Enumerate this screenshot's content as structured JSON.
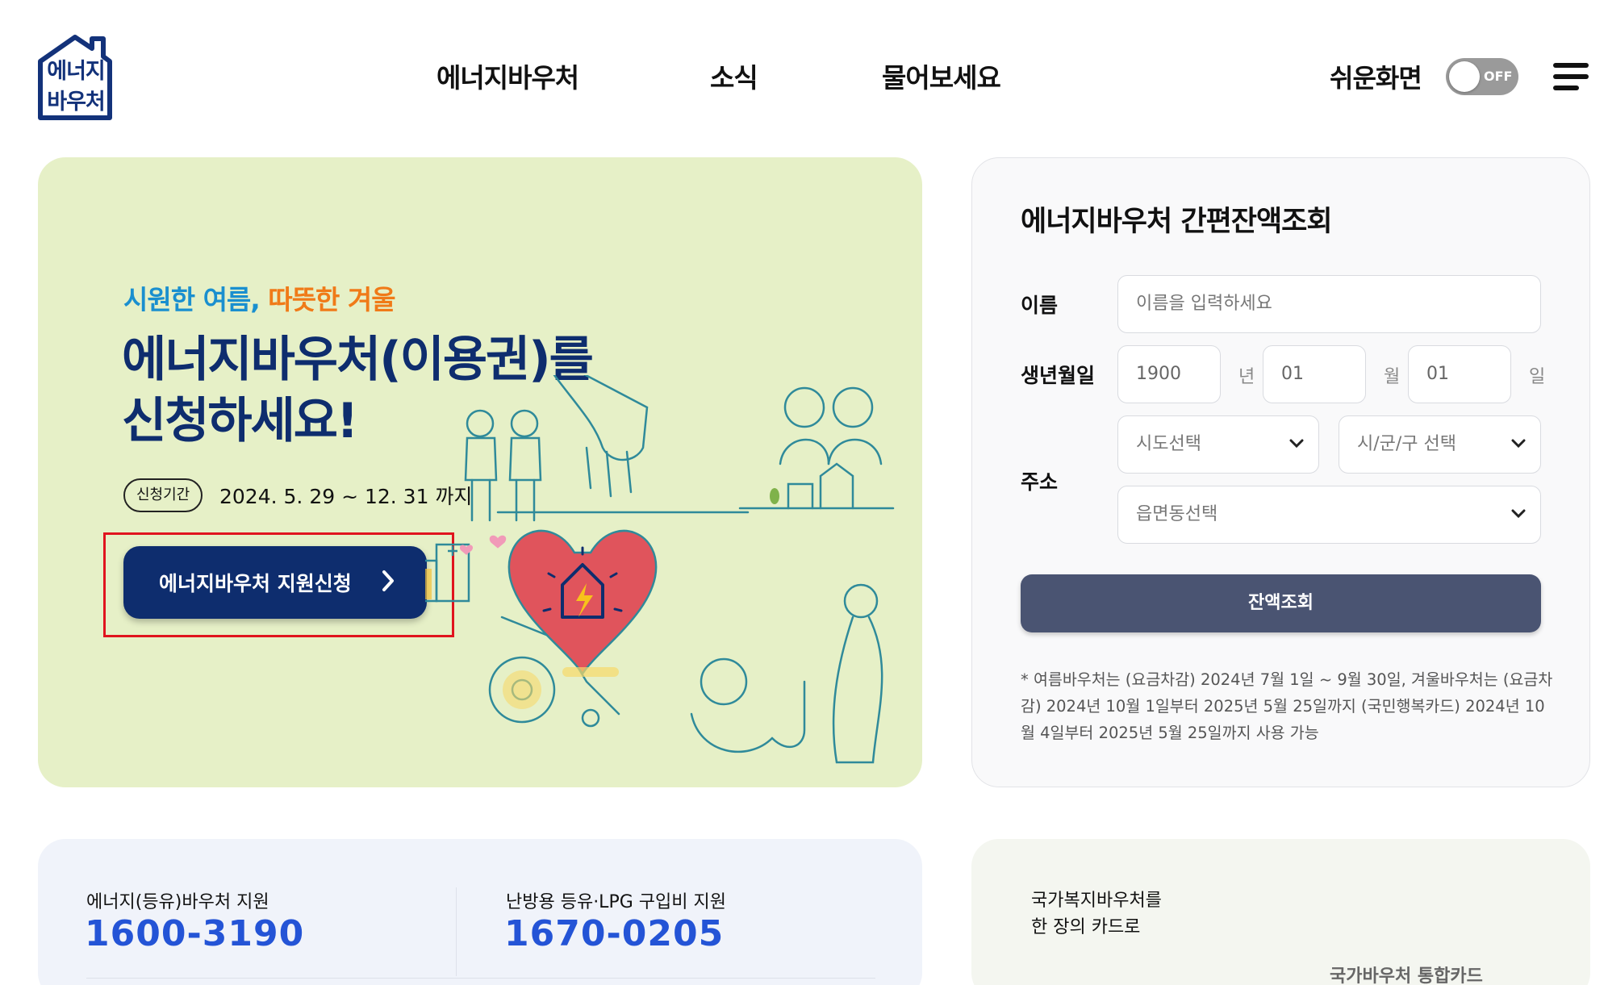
{
  "header": {
    "logo_line1": "에너지",
    "logo_line2": "바우처",
    "nav": [
      "에너지바우처",
      "소식",
      "물어보세요"
    ],
    "easy_screen_label": "쉬운화면",
    "toggle_state": "OFF"
  },
  "hero": {
    "subtitle_blue": "시원한 여름,",
    "subtitle_orange": "따뜻한 겨울",
    "title_line1": "에너지바우처(이용권)를",
    "title_line2": "신청하세요!",
    "period_badge": "신청기간",
    "period_text": "2024. 5. 29 ~ 12. 31 까지",
    "apply_button": "에너지바우처 지원신청"
  },
  "balance": {
    "title": "에너지바우처 간편잔액조회",
    "name_label": "이름",
    "name_placeholder": "이름을 입력하세요",
    "birth_label": "생년월일",
    "year_value": "1900",
    "year_unit": "년",
    "month_value": "01",
    "month_unit": "월",
    "day_value": "01",
    "day_unit": "일",
    "address_label": "주소",
    "sido_select": "시도선택",
    "sigungu_select": "시/군/구 선택",
    "eupmyeon_select": "읍면동선택",
    "check_button": "잔액조회",
    "note": "* 여름바우처는 (요금차감) 2024년 7월 1일 ~ 9월 30일, 겨울바우처는 (요금차감) 2024년 10월 1일부터 2025년 5월 25일까지 (국민행복카드) 2024년 10월 4일부터 2025년 5월 25일까지 사용 가능"
  },
  "contacts": [
    {
      "label": "에너지(등유)바우처 지원",
      "number": "1600-3190"
    },
    {
      "label": "난방용 등유·LPG 구입비 지원",
      "number": "1670-0205"
    }
  ],
  "promo": {
    "line1": "국가복지바우처를",
    "line2": "한 장의 카드로",
    "card_name": "국가바우처 통합카드"
  },
  "colors": {
    "brand_navy": "#0e2d6e",
    "hero_bg": "#e6f0c7",
    "accent_blue": "#1a8fcf",
    "accent_orange": "#f07a18",
    "phone_blue": "#2454d6",
    "highlight_red": "#e0141e",
    "check_button": "#4a5472"
  }
}
